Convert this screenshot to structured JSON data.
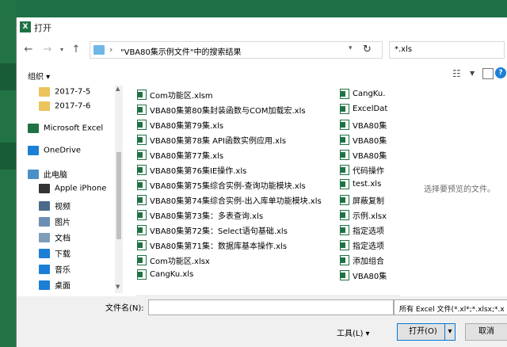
{
  "window": {
    "title": "打开"
  },
  "address": {
    "path": "\"VBA80集示例文件\"中的搜索结果",
    "search_query": "*.xls"
  },
  "toolbar": {
    "organize_label": "组织 ▾"
  },
  "nav": [
    {
      "label": "2017-7-5",
      "icon": "folder-icon",
      "color": "#ecc45c"
    },
    {
      "label": "2017-7-6",
      "icon": "folder-icon",
      "color": "#ecc45c"
    },
    {
      "label": "Microsoft Excel",
      "icon": "excel-icon",
      "color": "#1f7244"
    },
    {
      "label": "OneDrive",
      "icon": "cloud-icon",
      "color": "#1c7fd6"
    },
    {
      "label": "此电脑",
      "icon": "computer-icon",
      "color": "#4a90c8"
    },
    {
      "label": "Apple iPhone",
      "icon": "phone-icon",
      "color": "#333333"
    },
    {
      "label": "视频",
      "icon": "video-icon",
      "color": "#4a6b8a"
    },
    {
      "label": "图片",
      "icon": "picture-icon",
      "color": "#6b8fb3"
    },
    {
      "label": "文档",
      "icon": "document-icon",
      "color": "#7f9db8"
    },
    {
      "label": "下载",
      "icon": "download-icon",
      "color": "#1c7fd6"
    },
    {
      "label": "音乐",
      "icon": "music-icon",
      "color": "#1c7fd6"
    },
    {
      "label": "桌面",
      "icon": "desktop-icon",
      "color": "#1c7fd6"
    }
  ],
  "files_col1": [
    "Com功能区.xlsm",
    "VBA80集第80集封装函数与COM加载宏.xls",
    "VBA80集第79集.xls",
    "VBA80集第78集 API函数实例应用.xls",
    "VBA80集第77集.xls",
    "VBA80集第76集IE操作.xls",
    "VBA80集第75集综合实例-查询功能模块.xls",
    "VBA80集第74集综合实例-出入库单功能模块.xls",
    "VBA80集第73集：多表查询.xls",
    "VBA80集第72集：Select语句基础.xls",
    "VBA80集第71集：数据库基本操作.xls",
    "Com功能区.xlsx",
    "CangKu.xls"
  ],
  "files_col2": [
    "CangKu.",
    "ExcelDat",
    "VBA80集",
    "VBA80集",
    "VBA80集",
    "代码操作",
    "test.xls",
    "屏蔽复制",
    "示例.xlsx",
    "指定选项",
    "指定选项",
    "添加组合",
    "VBA80集"
  ],
  "preview": {
    "message": "选择要预览的文件。"
  },
  "bottom": {
    "filename_label": "文件名(N):",
    "filename_value": "",
    "filter_label": "所有 Excel 文件(*.xl*;*.xlsx;*.x",
    "tools_label": "工具(L)",
    "open_label": "打开(O)",
    "cancel_label": "取消"
  }
}
